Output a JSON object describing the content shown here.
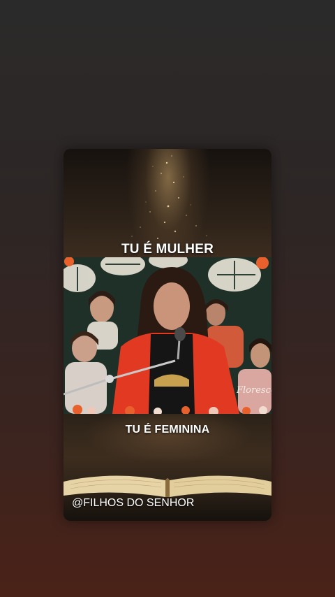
{
  "overlay": {
    "title_top": "TU É MULHER",
    "title_bottom": "TU É FEMININA",
    "handle": "@FILHOS DO  SENHOR"
  },
  "video": {
    "banner_text": "Florescer"
  },
  "colors": {
    "background_top": "#2b2a2a",
    "background_bottom": "#4a2218",
    "speaker_jacket": "#e23a22",
    "leaf_color": "#e9e6d8",
    "flower_accent": "#e8612c"
  }
}
